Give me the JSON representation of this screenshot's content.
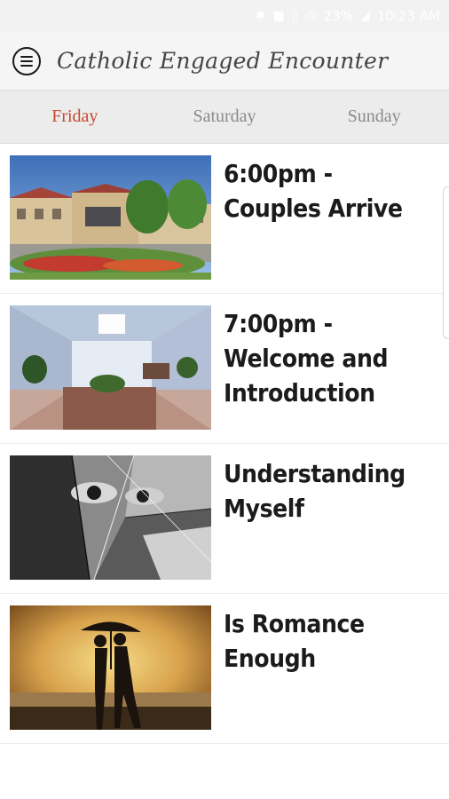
{
  "status_bar": {
    "battery": "23%",
    "time": "10:23 AM"
  },
  "app": {
    "title": "Catholic Engaged Encounter"
  },
  "tabs": [
    {
      "label": "Friday",
      "active": true
    },
    {
      "label": "Saturday",
      "active": false
    },
    {
      "label": "Sunday",
      "active": false
    }
  ],
  "colors": {
    "accent": "#c4492f",
    "inactive_tab": "#8a8a8a",
    "text": "#1b1b1b"
  },
  "schedule": [
    {
      "title": "6:00pm - Couples Arrive",
      "image": "retreat-center-building-photo"
    },
    {
      "title": "7:00pm - Welcome and Introduction",
      "image": "hallway-interior-photo"
    },
    {
      "title": "Understanding Myself",
      "image": "shattered-mirror-eyes-photo"
    },
    {
      "title": "Is Romance Enough",
      "image": "couple-under-umbrella-sunset-photo"
    }
  ]
}
